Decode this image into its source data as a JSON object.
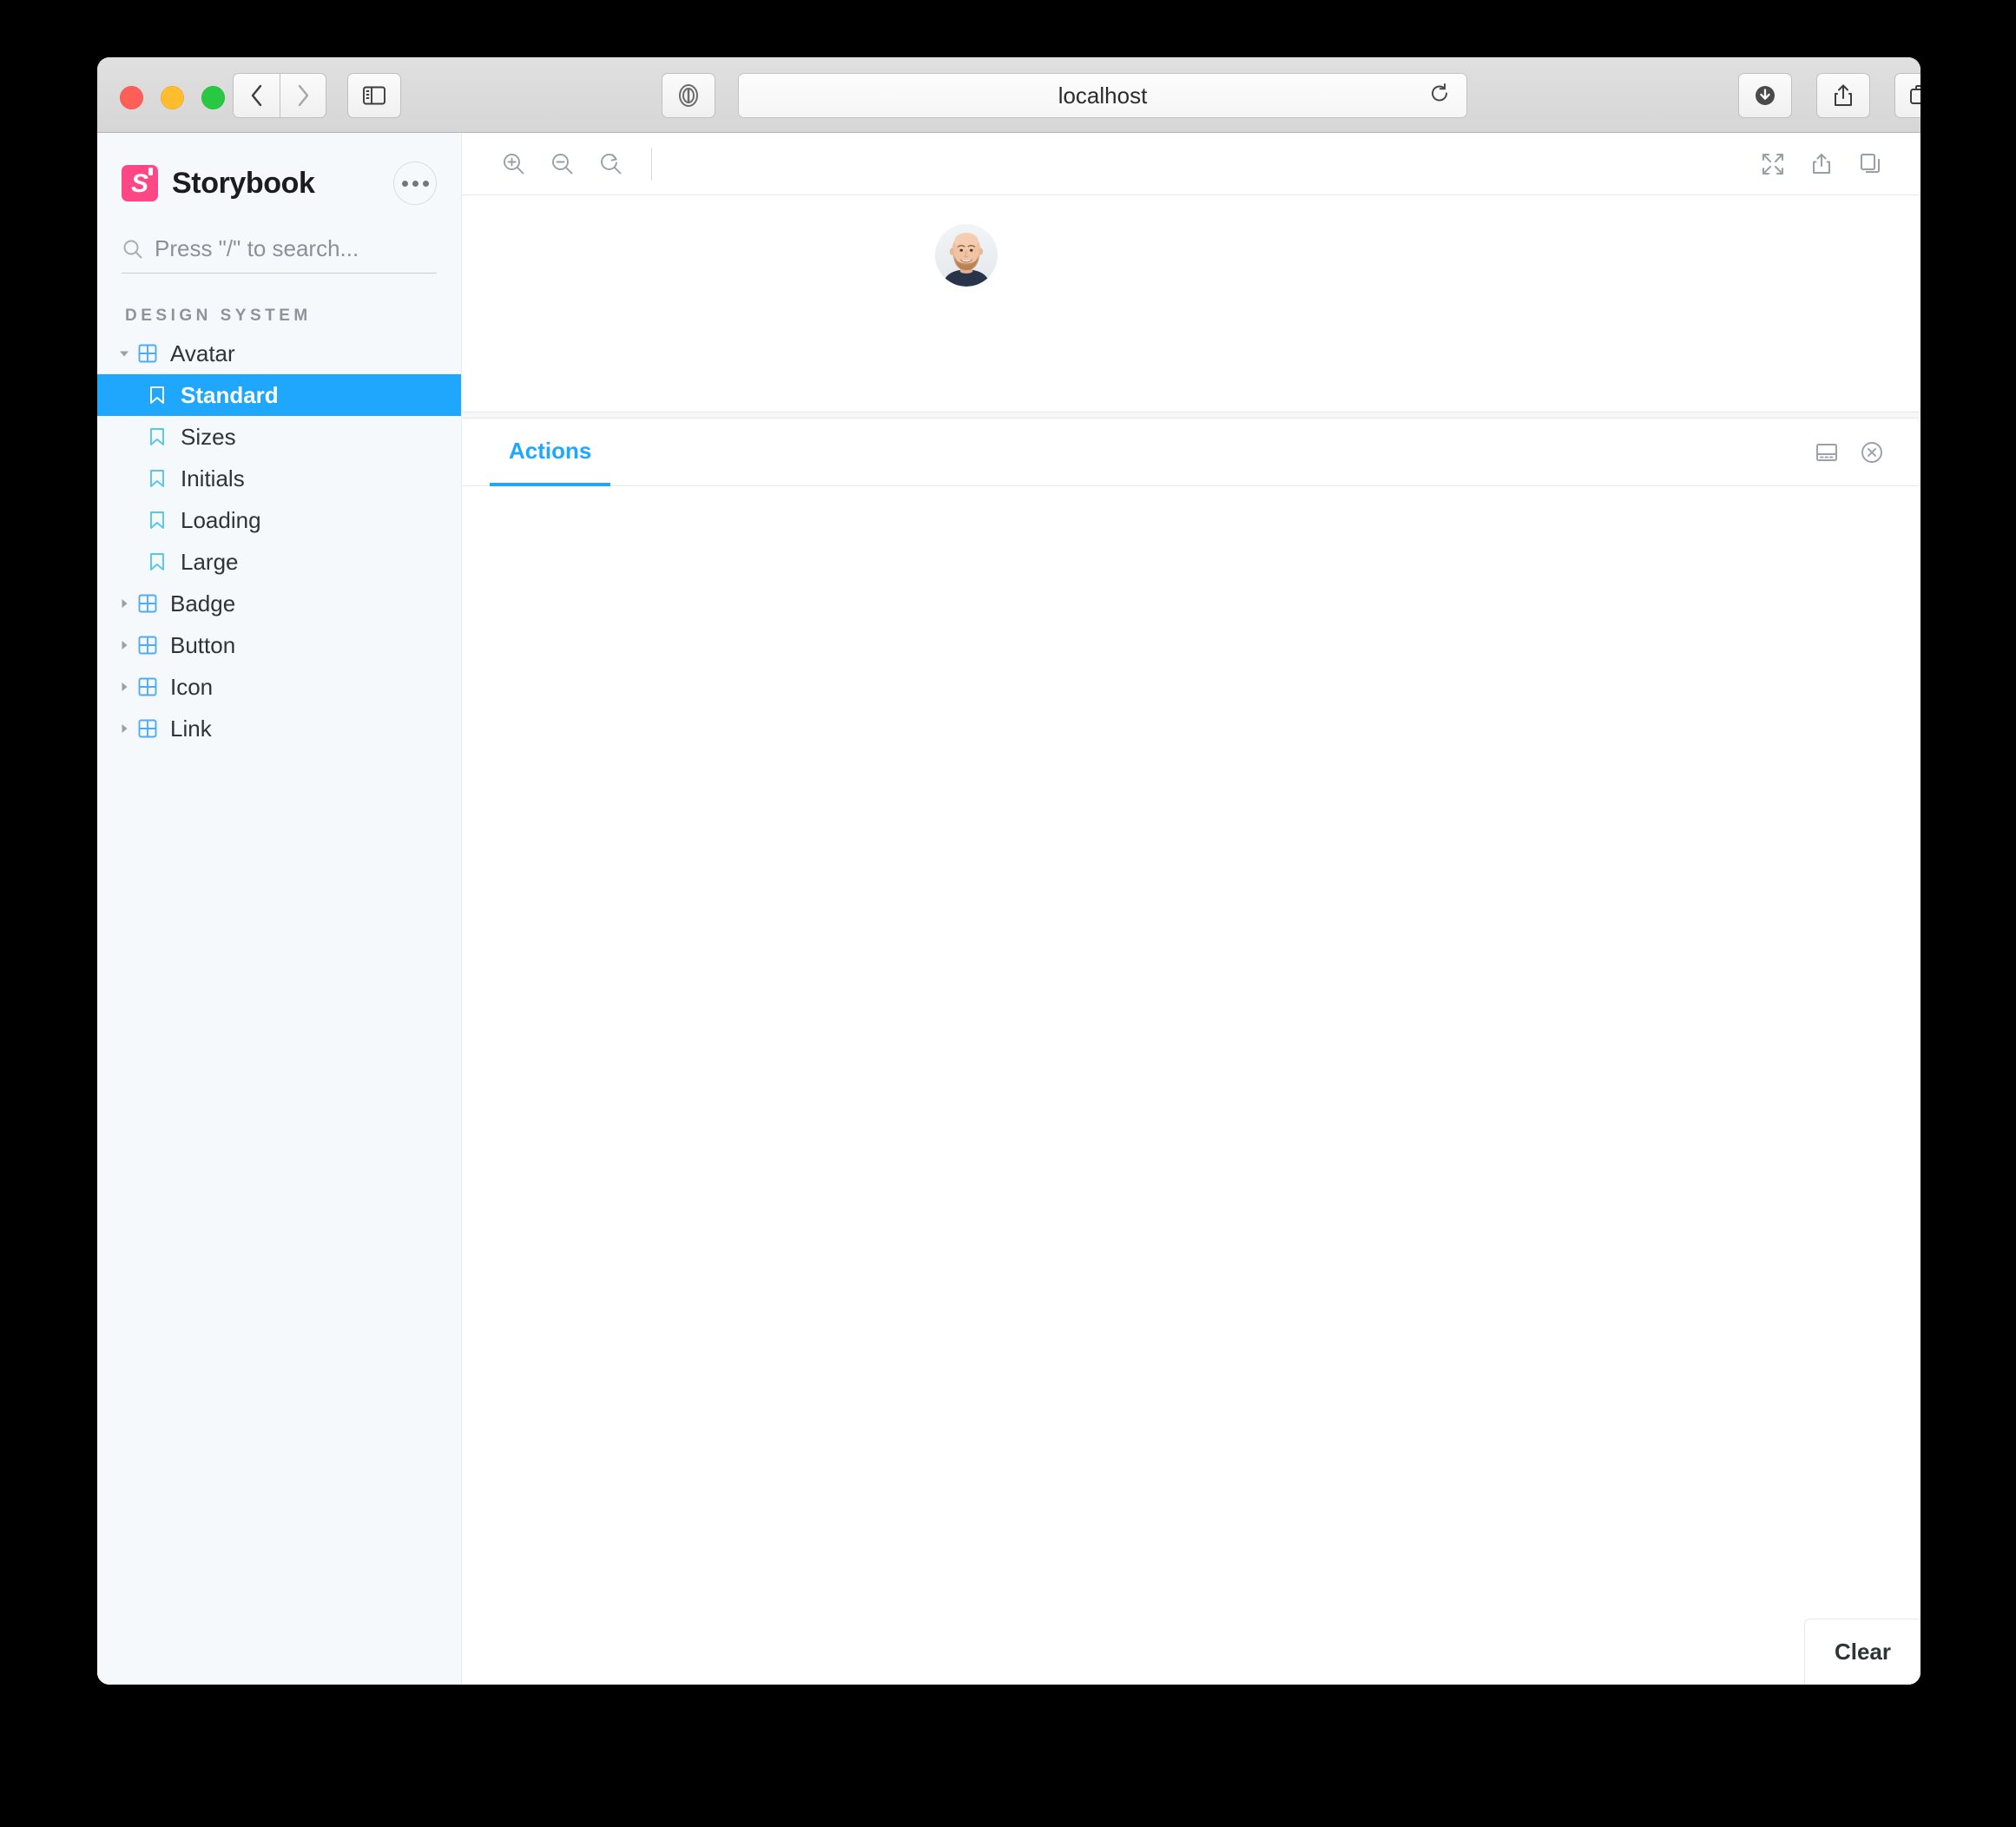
{
  "browser": {
    "url": "localhost",
    "buttons": {
      "back": "back-icon",
      "forward": "forward-icon",
      "sidebar": "sidebar-toggle-icon",
      "reader": "reader-icon",
      "reload": "reload-icon",
      "downloads": "downloads-icon",
      "share": "share-icon",
      "tab_overview": "tab-overview-icon",
      "new_tab": "+"
    }
  },
  "sidebar": {
    "brand": {
      "logo_letter": "S",
      "title": "Storybook"
    },
    "search": {
      "placeholder": "Press \"/\" to search..."
    },
    "section_title": "DESIGN SYSTEM",
    "tree": [
      {
        "label": "Avatar",
        "type": "component",
        "expanded": true,
        "selected": false
      },
      {
        "label": "Standard",
        "type": "story",
        "expanded": false,
        "selected": true
      },
      {
        "label": "Sizes",
        "type": "story",
        "expanded": false,
        "selected": false
      },
      {
        "label": "Initials",
        "type": "story",
        "expanded": false,
        "selected": false
      },
      {
        "label": "Loading",
        "type": "story",
        "expanded": false,
        "selected": false
      },
      {
        "label": "Large",
        "type": "story",
        "expanded": false,
        "selected": false
      },
      {
        "label": "Badge",
        "type": "component",
        "expanded": false,
        "selected": false
      },
      {
        "label": "Button",
        "type": "component",
        "expanded": false,
        "selected": false
      },
      {
        "label": "Icon",
        "type": "component",
        "expanded": false,
        "selected": false
      },
      {
        "label": "Link",
        "type": "component",
        "expanded": false,
        "selected": false
      }
    ]
  },
  "canvas": {
    "toolbar": {
      "zoom_in": "zoom-in-icon",
      "zoom_out": "zoom-out-icon",
      "zoom_reset": "zoom-reset-icon",
      "fullscreen": "expand-icon",
      "open_new_tab": "share-icon",
      "copy": "copy-icon"
    },
    "preview": {
      "component": "avatar"
    }
  },
  "addon_panel": {
    "tabs": [
      {
        "label": "Actions",
        "active": true
      }
    ],
    "controls": {
      "layout": "panel-position-icon",
      "close": "close-circle-icon"
    },
    "clear_label": "Clear",
    "entries": []
  },
  "colors": {
    "accent": "#1EA7FD",
    "brand": "#FF4785",
    "sidebar_bg": "#F6F9FC",
    "text": "#2E3438"
  }
}
